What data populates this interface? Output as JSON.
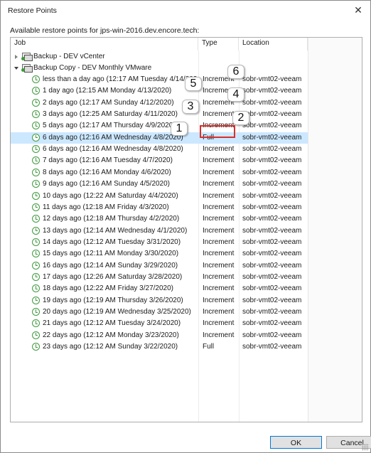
{
  "window": {
    "title": "Restore Points",
    "close_glyph": "✕"
  },
  "caption": "Available restore points for jps-win-2016.dev.encore.tech:",
  "columns": {
    "job": "Job",
    "type": "Type",
    "location": "Location"
  },
  "tree": {
    "job1": {
      "label": "Backup - DEV vCenter",
      "expanded": false
    },
    "job2": {
      "label": "Backup Copy - DEV Monthly VMware",
      "expanded": true
    }
  },
  "restore_points": [
    {
      "job": "less than a day ago (12:17 AM Tuesday 4/14/2020)",
      "type": "Increment",
      "location": "sobr-vmt02-veeam"
    },
    {
      "job": "1 day ago (12:15 AM Monday 4/13/2020)",
      "type": "Increment",
      "location": "sobr-vmt02-veeam"
    },
    {
      "job": "2 days ago (12:17 AM Sunday 4/12/2020)",
      "type": "Increment",
      "location": "sobr-vmt02-veeam"
    },
    {
      "job": "3 days ago (12:25 AM Saturday 4/11/2020)",
      "type": "Increment",
      "location": "sobr-vmt02-veeam"
    },
    {
      "job": "5 days ago (12:17 AM Thursday 4/9/2020)",
      "type": "Increment",
      "location": "sobr-vmt02-veeam"
    },
    {
      "job": "6 days ago (12:16 AM Wednesday 4/8/2020)",
      "type": "Full",
      "location": "sobr-vmt02-veeam"
    },
    {
      "job": "6 days ago (12:16 AM Wednesday 4/8/2020)",
      "type": "Increment",
      "location": "sobr-vmt02-veeam"
    },
    {
      "job": "7 days ago (12:16 AM Tuesday 4/7/2020)",
      "type": "Increment",
      "location": "sobr-vmt02-veeam"
    },
    {
      "job": "8 days ago (12:16 AM Monday 4/6/2020)",
      "type": "Increment",
      "location": "sobr-vmt02-veeam"
    },
    {
      "job": "9 days ago (12:16 AM Sunday 4/5/2020)",
      "type": "Increment",
      "location": "sobr-vmt02-veeam"
    },
    {
      "job": "10 days ago (12:22 AM Saturday 4/4/2020)",
      "type": "Increment",
      "location": "sobr-vmt02-veeam"
    },
    {
      "job": "11 days ago (12:18 AM Friday 4/3/2020)",
      "type": "Increment",
      "location": "sobr-vmt02-veeam"
    },
    {
      "job": "12 days ago (12:18 AM Thursday 4/2/2020)",
      "type": "Increment",
      "location": "sobr-vmt02-veeam"
    },
    {
      "job": "13 days ago (12:14 AM Wednesday 4/1/2020)",
      "type": "Increment",
      "location": "sobr-vmt02-veeam"
    },
    {
      "job": "14 days ago (12:12 AM Tuesday 3/31/2020)",
      "type": "Increment",
      "location": "sobr-vmt02-veeam"
    },
    {
      "job": "15 days ago (12:11 AM Monday 3/30/2020)",
      "type": "Increment",
      "location": "sobr-vmt02-veeam"
    },
    {
      "job": "16 days ago (12:14 AM Sunday 3/29/2020)",
      "type": "Increment",
      "location": "sobr-vmt02-veeam"
    },
    {
      "job": "17 days ago (12:26 AM Saturday 3/28/2020)",
      "type": "Increment",
      "location": "sobr-vmt02-veeam"
    },
    {
      "job": "18 days ago (12:22 AM Friday 3/27/2020)",
      "type": "Increment",
      "location": "sobr-vmt02-veeam"
    },
    {
      "job": "19 days ago (12:19 AM Thursday 3/26/2020)",
      "type": "Increment",
      "location": "sobr-vmt02-veeam"
    },
    {
      "job": "20 days ago (12:19 AM Wednesday 3/25/2020)",
      "type": "Increment",
      "location": "sobr-vmt02-veeam"
    },
    {
      "job": "21 days ago (12:12 AM Tuesday 3/24/2020)",
      "type": "Increment",
      "location": "sobr-vmt02-veeam"
    },
    {
      "job": "22 days ago (12:12 AM Monday 3/23/2020)",
      "type": "Increment",
      "location": "sobr-vmt02-veeam"
    },
    {
      "job": "23 days ago (12:12 AM Sunday 3/22/2020)",
      "type": "Full",
      "location": "sobr-vmt02-veeam"
    }
  ],
  "selected_row_index": 5,
  "callouts": [
    "1",
    "2",
    "3",
    "4",
    "5",
    "6"
  ],
  "buttons": {
    "ok": "OK",
    "cancel": "Cancel"
  },
  "colors": {
    "selection": "#cce8ff",
    "icon_green": "#3f9a3f",
    "highlight_red": "#d9302b",
    "ok_border": "#0078d7"
  }
}
